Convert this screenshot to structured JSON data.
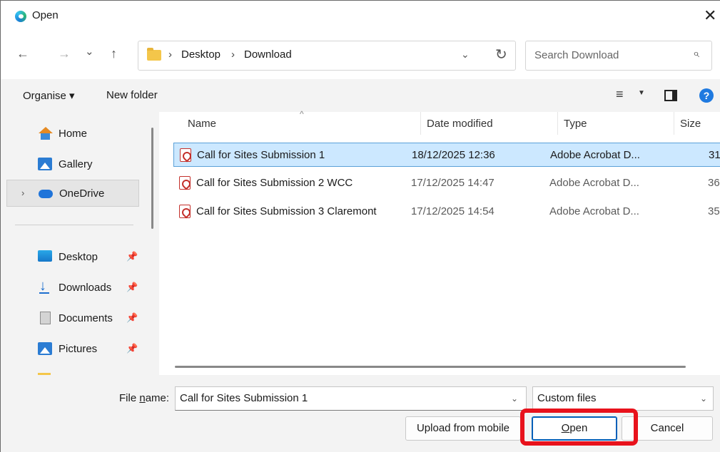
{
  "window": {
    "title": "Open",
    "close_label": "✕"
  },
  "nav": {
    "back_label": "←",
    "forward_label": "→",
    "history_label": "⌄",
    "up_label": "↑",
    "breadcrumbs": [
      "Desktop",
      "Download"
    ],
    "separator": "›",
    "dropdown_label": "⌄",
    "refresh_label": "↻"
  },
  "search": {
    "placeholder": "Search Download",
    "icon": "⌕"
  },
  "toolbar": {
    "organise_label": "Organise ▾",
    "new_folder_label": "New folder",
    "view_label": "≡",
    "view_dd": "▼",
    "help_label": "?"
  },
  "sidebar": {
    "items": [
      {
        "label": "Home",
        "icon": "home-icon"
      },
      {
        "label": "Gallery",
        "icon": "gallery-icon"
      },
      {
        "label": "OneDrive",
        "icon": "onedrive-icon",
        "selected": true,
        "chevron": "›"
      },
      {
        "label": "Desktop",
        "icon": "desktop-icon",
        "pinned": true
      },
      {
        "label": "Downloads",
        "icon": "downloads-icon",
        "pinned": true
      },
      {
        "label": "Documents",
        "icon": "documents-icon",
        "pinned": true
      },
      {
        "label": "Pictures",
        "icon": "pictures-icon",
        "pinned": true
      }
    ],
    "pin_glyph": "📌"
  },
  "filelist": {
    "columns": [
      "Name",
      "Date modified",
      "Type",
      "Size"
    ],
    "sort_caret": "^",
    "rows": [
      {
        "name": "Call for Sites Submission 1",
        "date": "18/12/2025 12:36",
        "type": "Adobe Acrobat D...",
        "size": "31",
        "selected": true
      },
      {
        "name": "Call for Sites Submission 2 WCC",
        "date": "17/12/2025 14:47",
        "type": "Adobe Acrobat D...",
        "size": "36",
        "selected": false
      },
      {
        "name": "Call for Sites Submission 3 Claremont",
        "date": "17/12/2025 14:54",
        "type": "Adobe Acrobat D...",
        "size": "35",
        "selected": false
      }
    ]
  },
  "bottom": {
    "file_name_label_pre": "File ",
    "file_name_label_u": "n",
    "file_name_label_post": "ame:",
    "file_name_value": "Call for Sites Submission 1",
    "filter_value": "Custom files",
    "dd_glyph": "⌄",
    "upload_label": "Upload from mobile",
    "open_label_u": "O",
    "open_label_rest": "pen",
    "cancel_label": "Cancel"
  },
  "colors": {
    "accent": "#005fb8",
    "highlight": "#e8121c",
    "selection": "#cce8ff"
  }
}
